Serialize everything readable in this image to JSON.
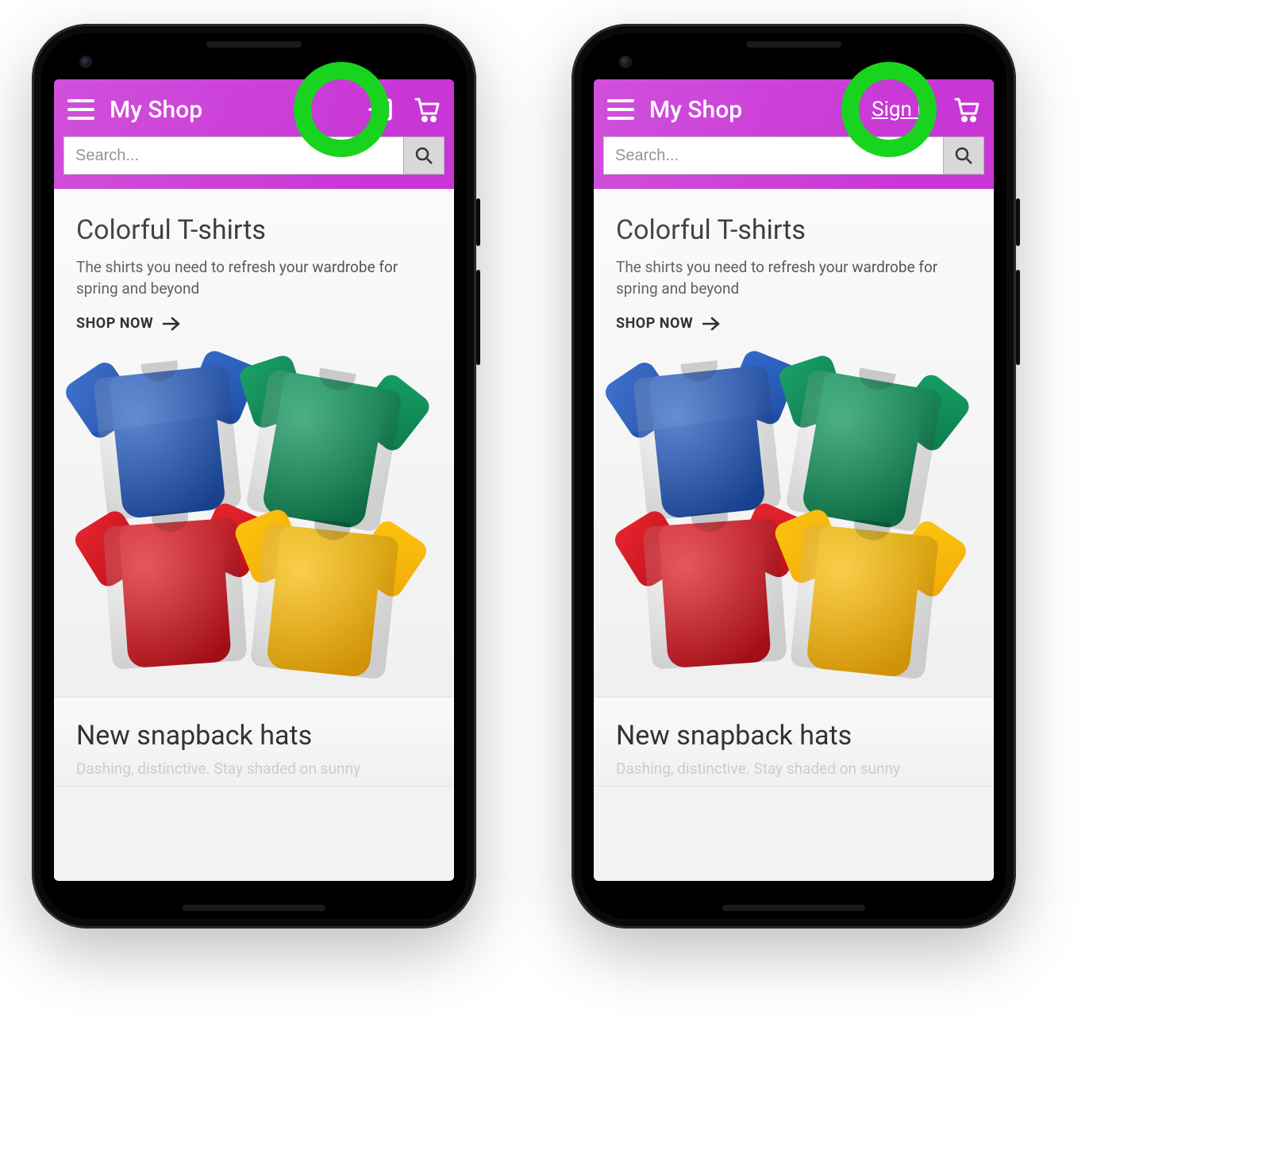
{
  "app": {
    "title": "My Shop",
    "signin_label": "Sign in",
    "search_placeholder": "Search..."
  },
  "colors": {
    "accent": "#c936d6",
    "highlight_ring": "#19d41f"
  },
  "cards": [
    {
      "title": "Colorful T-shirts",
      "subtitle": "The shirts you need to refresh your wardrobe for spring and beyond",
      "cta": "SHOP NOW",
      "image_alt": "tshirts-illustration"
    },
    {
      "title": "New snapback hats",
      "subtitle_preview": "Dashing, distinctive. Stay shaded on sunny"
    }
  ],
  "variants": [
    {
      "signin_style": "icon"
    },
    {
      "signin_style": "text"
    }
  ]
}
